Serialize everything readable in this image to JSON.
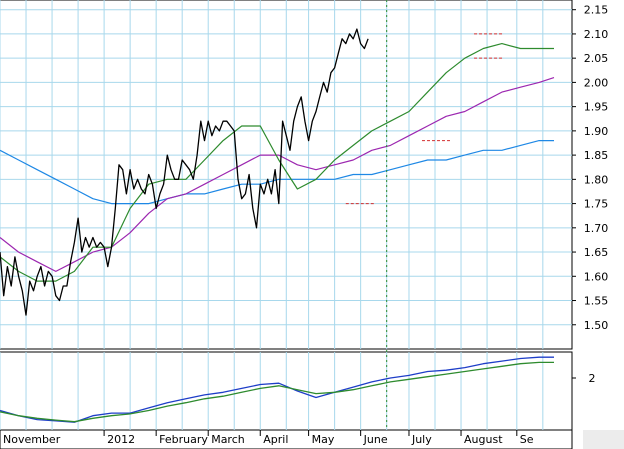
{
  "chart_data": {
    "type": "line",
    "price_panel": {
      "ylim": [
        1.45,
        2.17
      ],
      "yticks": [
        "1.50",
        "1.55",
        "1.60",
        "1.65",
        "1.70",
        "1.75",
        "1.80",
        "1.85",
        "1.90",
        "1.95",
        "2.00",
        "2.05",
        "2.10",
        "2.15"
      ],
      "series": [
        {
          "role": "price",
          "color": "#000000",
          "x": [
            0,
            2,
            4,
            6,
            8,
            10,
            12,
            14,
            16,
            18,
            20,
            22,
            24,
            26,
            28,
            30,
            32,
            34,
            36,
            38,
            40,
            42,
            44,
            46,
            48,
            50,
            52,
            54,
            56,
            58,
            60,
            62,
            64,
            66,
            68,
            70,
            72,
            74,
            76,
            78,
            80,
            82,
            84,
            86,
            88,
            90,
            92,
            94,
            96,
            98,
            100,
            102,
            104,
            106,
            108,
            110,
            112,
            114,
            116,
            118,
            120,
            122,
            124,
            126,
            128,
            130,
            132,
            134,
            136,
            138,
            140,
            142,
            144,
            146,
            148,
            150,
            152,
            154,
            156,
            158,
            160,
            162,
            164,
            166,
            168,
            170,
            172,
            174,
            176,
            178,
            180,
            182,
            184,
            186,
            188,
            190,
            192,
            194,
            196,
            198,
            200,
            202,
            204,
            206,
            208,
            210,
            212,
            214,
            216,
            218,
            220,
            222,
            224,
            226,
            228,
            230,
            232,
            234,
            236,
            238,
            240,
            242,
            244,
            246,
            248,
            250,
            252,
            254,
            256,
            258,
            260,
            262,
            264,
            266,
            268,
            270,
            272,
            274,
            276,
            278,
            280,
            282,
            284,
            286,
            288,
            290,
            292,
            294,
            296,
            298
          ],
          "values": [
            1.65,
            1.56,
            1.62,
            1.58,
            1.64,
            1.6,
            1.57,
            1.52,
            1.59,
            1.57,
            1.6,
            1.62,
            1.58,
            1.61,
            1.6,
            1.56,
            1.55,
            1.58,
            1.58,
            1.63,
            1.67,
            1.72,
            1.65,
            1.68,
            1.66,
            1.68,
            1.66,
            1.67,
            1.66,
            1.62,
            1.66,
            1.74,
            1.83,
            1.82,
            1.77,
            1.82,
            1.78,
            1.8,
            1.78,
            1.77,
            1.81,
            1.79,
            1.74,
            1.77,
            1.79,
            1.85,
            1.82,
            1.8,
            1.8,
            1.84,
            1.83,
            1.82,
            1.8,
            1.85,
            1.92,
            1.88,
            1.92,
            1.89,
            1.91,
            1.9,
            1.92,
            1.92,
            1.91,
            1.9,
            1.8,
            1.76,
            1.77,
            1.81,
            1.74,
            1.7,
            1.79,
            1.77,
            1.8,
            1.77,
            1.82,
            1.75,
            1.92,
            1.89,
            1.86,
            1.92,
            1.95,
            1.97,
            1.92,
            1.88,
            1.92,
            1.94,
            1.97,
            2.0,
            1.98,
            2.02,
            2.03,
            2.06,
            2.09,
            2.08,
            2.1,
            2.09,
            2.11,
            2.08,
            2.07,
            2.09
          ]
        },
        {
          "role": "short-average",
          "color": "#2e8b2e",
          "x": [
            0,
            10,
            20,
            30,
            40,
            50,
            60,
            70,
            80,
            90,
            100,
            110,
            120,
            130,
            140,
            150,
            160,
            170,
            180,
            190,
            200,
            210,
            220,
            230,
            240,
            250,
            260,
            270,
            280,
            290,
            298
          ],
          "values": [
            1.64,
            1.61,
            1.59,
            1.59,
            1.61,
            1.66,
            1.66,
            1.74,
            1.79,
            1.8,
            1.8,
            1.84,
            1.88,
            1.91,
            1.91,
            1.84,
            1.78,
            1.8,
            1.84,
            1.87,
            1.9,
            1.92,
            1.94,
            1.98,
            2.02,
            2.05,
            2.07,
            2.08,
            2.07,
            2.07,
            2.07
          ]
        },
        {
          "role": "medium-average",
          "color": "#9c27b0",
          "x": [
            0,
            10,
            20,
            30,
            40,
            50,
            60,
            70,
            80,
            90,
            100,
            110,
            120,
            130,
            140,
            150,
            160,
            170,
            180,
            190,
            200,
            210,
            220,
            230,
            240,
            250,
            260,
            270,
            280,
            290,
            298
          ],
          "values": [
            1.68,
            1.65,
            1.63,
            1.61,
            1.63,
            1.65,
            1.66,
            1.69,
            1.73,
            1.76,
            1.77,
            1.79,
            1.81,
            1.83,
            1.85,
            1.85,
            1.83,
            1.82,
            1.83,
            1.84,
            1.86,
            1.87,
            1.89,
            1.91,
            1.93,
            1.94,
            1.96,
            1.98,
            1.99,
            2.0,
            2.01
          ]
        },
        {
          "role": "long-average",
          "color": "#1e88e5",
          "x": [
            0,
            10,
            20,
            30,
            40,
            50,
            60,
            70,
            80,
            90,
            100,
            110,
            120,
            130,
            140,
            150,
            160,
            170,
            180,
            190,
            200,
            210,
            220,
            230,
            240,
            250,
            260,
            270,
            280,
            290,
            298
          ],
          "values": [
            1.86,
            1.84,
            1.82,
            1.8,
            1.78,
            1.76,
            1.75,
            1.75,
            1.75,
            1.76,
            1.77,
            1.77,
            1.78,
            1.79,
            1.79,
            1.8,
            1.8,
            1.8,
            1.8,
            1.81,
            1.81,
            1.82,
            1.83,
            1.84,
            1.84,
            1.85,
            1.86,
            1.86,
            1.87,
            1.88,
            1.88
          ]
        }
      ],
      "markers": [
        {
          "x": 227,
          "y": 1.88,
          "color": "#d32f2f"
        },
        {
          "x": 186,
          "y": 1.75,
          "color": "#d32f2f"
        },
        {
          "x": 255,
          "y": 2.1,
          "color": "#d32f2f"
        },
        {
          "x": 255,
          "y": 2.05,
          "color": "#d32f2f"
        }
      ]
    },
    "indicator_panel": {
      "ylim": [
        0,
        3
      ],
      "yticks": [
        "2"
      ],
      "series": [
        {
          "color": "#1e3ec8",
          "x": [
            0,
            10,
            20,
            30,
            40,
            50,
            60,
            70,
            80,
            90,
            100,
            110,
            120,
            130,
            140,
            150,
            160,
            170,
            180,
            190,
            200,
            210,
            220,
            230,
            240,
            250,
            260,
            270,
            280,
            290,
            298
          ],
          "values": [
            0.75,
            0.55,
            0.4,
            0.35,
            0.3,
            0.55,
            0.65,
            0.65,
            0.85,
            1.05,
            1.2,
            1.35,
            1.45,
            1.6,
            1.75,
            1.8,
            1.5,
            1.25,
            1.45,
            1.65,
            1.85,
            2.0,
            2.1,
            2.25,
            2.3,
            2.4,
            2.55,
            2.65,
            2.75,
            2.8,
            2.8
          ]
        },
        {
          "color": "#2e8b2e",
          "x": [
            0,
            10,
            20,
            30,
            40,
            50,
            60,
            70,
            80,
            90,
            100,
            110,
            120,
            130,
            140,
            150,
            160,
            170,
            180,
            190,
            200,
            210,
            220,
            230,
            240,
            250,
            260,
            270,
            280,
            290,
            298
          ],
          "values": [
            0.7,
            0.55,
            0.45,
            0.38,
            0.32,
            0.45,
            0.55,
            0.62,
            0.75,
            0.92,
            1.05,
            1.2,
            1.3,
            1.45,
            1.6,
            1.7,
            1.55,
            1.4,
            1.45,
            1.55,
            1.7,
            1.85,
            1.95,
            2.05,
            2.15,
            2.25,
            2.35,
            2.45,
            2.55,
            2.6,
            2.6
          ]
        }
      ]
    },
    "x_axis": {
      "range": [
        0,
        300
      ],
      "months": [
        {
          "label": "November",
          "x": 0
        },
        {
          "label": "2012",
          "x": 56
        },
        {
          "label": "February",
          "x": 84
        },
        {
          "label": "March",
          "x": 112
        },
        {
          "label": "April",
          "x": 140
        },
        {
          "label": "May",
          "x": 166
        },
        {
          "label": "June",
          "x": 194
        },
        {
          "label": "July",
          "x": 220
        },
        {
          "label": "August",
          "x": 248
        },
        {
          "label": "Se",
          "x": 278
        }
      ],
      "gridlines": [
        0,
        14,
        28,
        42,
        56,
        70,
        84,
        98,
        112,
        126,
        140,
        154,
        166,
        180,
        194,
        208,
        220,
        234,
        248,
        262,
        278,
        292
      ],
      "dashed_line_x": 208
    },
    "grid": true
  }
}
